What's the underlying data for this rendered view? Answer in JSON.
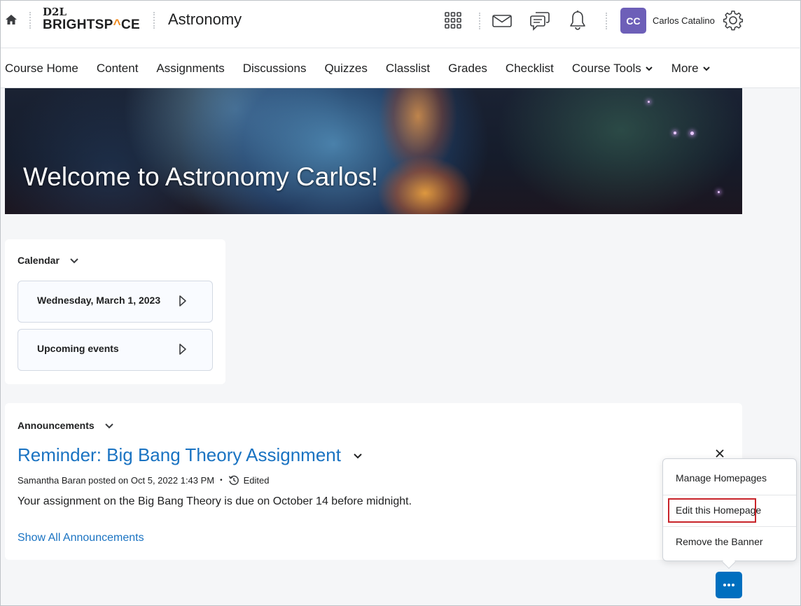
{
  "header": {
    "logo_top": "D2L",
    "logo_brand_part1": "BRIGHTSP",
    "logo_brand_accent": "^",
    "logo_brand_part2": "CE",
    "course_title": "Astronomy",
    "user_initials": "CC",
    "user_name": "Carlos Catalino",
    "icons": [
      "home-icon",
      "apps-grid-icon",
      "mail-icon",
      "chat-icon",
      "bell-icon",
      "gear-icon"
    ]
  },
  "nav": {
    "items": [
      {
        "label": "Course Home"
      },
      {
        "label": "Content"
      },
      {
        "label": "Assignments"
      },
      {
        "label": "Discussions"
      },
      {
        "label": "Quizzes"
      },
      {
        "label": "Classlist"
      },
      {
        "label": "Grades"
      },
      {
        "label": "Checklist"
      },
      {
        "label": "Course Tools",
        "dropdown": true
      },
      {
        "label": "More",
        "dropdown": true
      }
    ]
  },
  "banner": {
    "title": "Welcome to Astronomy Carlos!"
  },
  "calendar": {
    "title": "Calendar",
    "items": [
      {
        "label": "Wednesday, March 1, 2023"
      },
      {
        "label": "Upcoming events"
      }
    ]
  },
  "announcements": {
    "title": "Announcements",
    "item_title": "Reminder: Big Bang Theory Assignment",
    "meta_author": "Samantha Baran posted on Oct 5, 2022 1:43 PM",
    "meta_dot": "•",
    "meta_edited": "Edited",
    "body": "Your assignment on the Big Bang Theory is due on October 14 before midnight.",
    "show_all": "Show All Announcements"
  },
  "context_menu": {
    "items": [
      {
        "label": "Manage Homepages"
      },
      {
        "label": "Edit this Homepage",
        "highlighted": true
      },
      {
        "label": "Remove the Banner"
      }
    ]
  },
  "colors": {
    "link": "#1a73c2",
    "avatar_bg": "#6d5fb8",
    "primary_button": "#006fbf",
    "highlight_border": "#c8242a",
    "logo_accent": "#f18b20"
  }
}
